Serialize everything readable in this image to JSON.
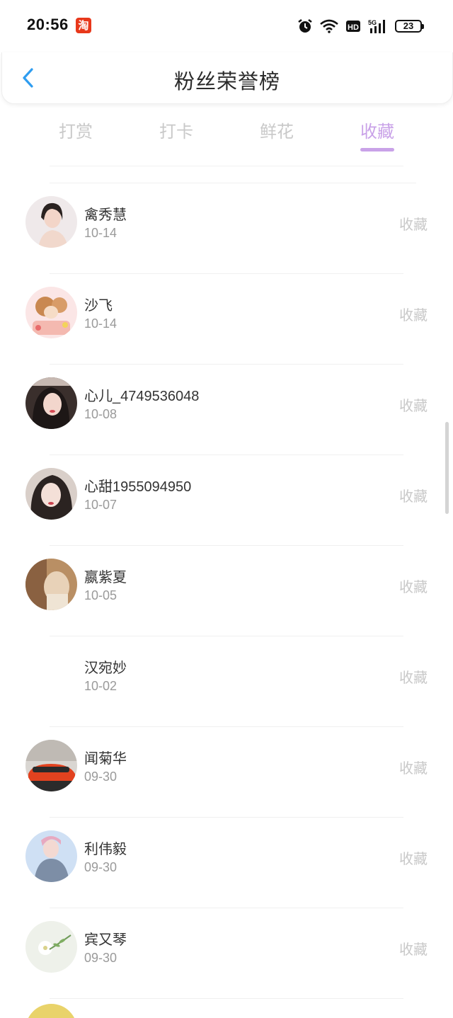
{
  "status_bar": {
    "time": "20:56",
    "taobao_badge": "淘",
    "battery": "23"
  },
  "header": {
    "title": "粉丝荣誉榜"
  },
  "tabs": [
    {
      "label": "打赏",
      "active": false
    },
    {
      "label": "打卡",
      "active": false
    },
    {
      "label": "鲜花",
      "active": false
    },
    {
      "label": "收藏",
      "active": true
    }
  ],
  "colors": {
    "accent": "#c9a2e8",
    "back_arrow": "#2f9df0",
    "muted_text": "#c8c8c8"
  },
  "fans": [
    {
      "name": "禽秀慧",
      "date": "10-14",
      "action": "收藏",
      "avatar": "portrait-avatar"
    },
    {
      "name": "沙飞",
      "date": "10-14",
      "action": "收藏",
      "avatar": "cartoon-avatar"
    },
    {
      "name": "心儿_4749536048",
      "date": "10-08",
      "action": "收藏",
      "avatar": "portrait-avatar"
    },
    {
      "name": "心甜1955094950",
      "date": "10-07",
      "action": "收藏",
      "avatar": "portrait-avatar"
    },
    {
      "name": "嬴紫夏",
      "date": "10-05",
      "action": "收藏",
      "avatar": "photo-avatar"
    },
    {
      "name": "汉宛妙",
      "date": "10-02",
      "action": "收藏",
      "avatar": "none"
    },
    {
      "name": "闻菊华",
      "date": "09-30",
      "action": "收藏",
      "avatar": "car-avatar"
    },
    {
      "name": "利伟毅",
      "date": "09-30",
      "action": "收藏",
      "avatar": "portrait-avatar"
    },
    {
      "name": "宾又琴",
      "date": "09-30",
      "action": "收藏",
      "avatar": "flower-avatar"
    }
  ]
}
